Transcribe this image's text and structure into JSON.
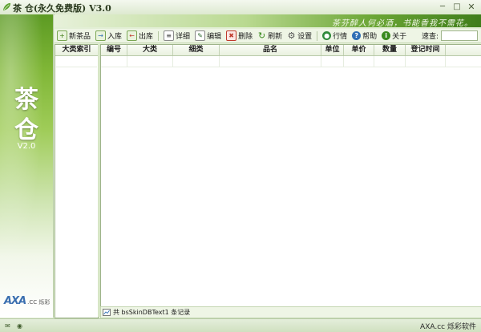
{
  "window": {
    "title": "茶 仓(永久免费版)  V3.0",
    "slogan": "茶芬醉人何必酒，书能香我不需花。"
  },
  "brand": {
    "name": "茶仓",
    "name_line1": "茶",
    "name_line2": "仓",
    "version": "V2.0",
    "logo_text": "AXA",
    "logo_suffix": ".CC 烁彩"
  },
  "toolbar": {
    "buttons": [
      {
        "label": "新茶品",
        "icon": "new-item-icon"
      },
      {
        "label": "入库",
        "icon": "stock-in-icon"
      },
      {
        "label": "出库",
        "icon": "stock-out-icon"
      },
      {
        "label": "详细",
        "icon": "details-icon"
      },
      {
        "label": "编辑",
        "icon": "edit-icon"
      },
      {
        "label": "删除",
        "icon": "delete-icon"
      },
      {
        "label": "刷新",
        "icon": "refresh-icon"
      },
      {
        "label": "设置",
        "icon": "settings-icon"
      },
      {
        "label": "行情",
        "icon": "market-icon"
      },
      {
        "label": "帮助",
        "icon": "help-icon"
      },
      {
        "label": "关于",
        "icon": "about-icon"
      }
    ],
    "search_label": "速查:",
    "search_value": ""
  },
  "category_panel": {
    "header": "大类索引"
  },
  "grid": {
    "columns": [
      "编号",
      "大类",
      "细类",
      "品名",
      "单位",
      "单价",
      "数量",
      "登记时间"
    ],
    "rows": []
  },
  "record_bar": {
    "text": "共 bsSkinDBText1 条记录"
  },
  "status": {
    "company": "AXA.cc 烁彩软件"
  },
  "colors": {
    "accent": "#4f8f1e",
    "background": "#e3efd6"
  }
}
